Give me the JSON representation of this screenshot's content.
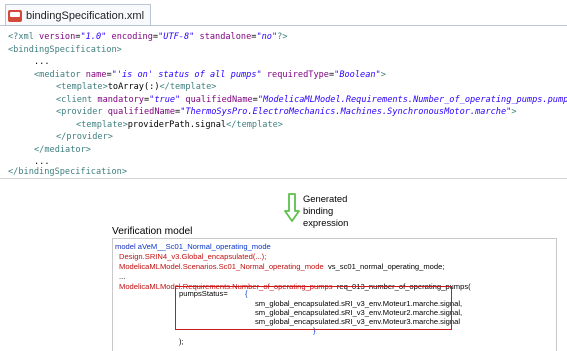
{
  "tab": {
    "filename": "bindingSpecification.xml",
    "icon": "xml-file-icon"
  },
  "xml": {
    "l1": {
      "pi_open": "<?xml ",
      "a1": "version",
      "v1": "\"1.0\"",
      "a2": "encoding",
      "v2": "\"UTF-8\"",
      "a3": "standalone",
      "v3": "\"no\"",
      "pi_close": "?>"
    },
    "l2": "<bindingSpecification>",
    "l3": "...",
    "l4": {
      "open": "<mediator ",
      "a1": "name",
      "v1": "\"'is on' status of all pumps\"",
      "a2": "requiredType",
      "v2": "\"Boolean\"",
      "close": ">"
    },
    "l5": {
      "open": "<template>",
      "text": "toArray(:)",
      "close": "</template>"
    },
    "l6": {
      "open": "<client ",
      "a1": "mandatory",
      "v1": "\"true\"",
      "a2": "qualifiedName",
      "v2": "\"ModelicaMLModel.Requirements.Number_of_operating_pumps.pumpsOnStatus\"",
      "close": "/"
    },
    "l7": {
      "open": "<provider ",
      "a1": "qualifiedName",
      "v1": "\"ThermoSysPro.ElectroMechanics.Machines.SynchronousMotor.marche\"",
      "close": ">"
    },
    "l8": {
      "open": "<template>",
      "text": "providerPath.signal",
      "close": "</template>"
    },
    "l9": "</provider>",
    "l10": "</mediator>",
    "l11": "...",
    "l12": "</bindingSpecification>"
  },
  "arrow": {
    "icon": "down-arrow-icon",
    "line1": "Generated",
    "line2": "binding",
    "line3": "expression"
  },
  "verification": {
    "title": "Verification model",
    "code": {
      "l1_kw": "model",
      "l1_text": " aVeM__Sc01_Normal_operating_mode",
      "l2": "Design.SRIN4_v3.Global_encapsulated(...);",
      "l3_red": "ModelicaMLModel.Scenarios.Sc01_Normal_operating_mode",
      "l3_text": "  vs_sc01_normal_operating_mode;",
      "l4": "...",
      "l5_red": "ModelicaMLModel.Requirements.Number_of_operating_pumps",
      "l5_text": "  req_013_number_of_operating_pumps(",
      "l6_name": "pumpsStatus=",
      "l6_brace": "{",
      "l7": "sm_global_encapsulated.sRI_v3_env.Moteur1.marche.signal,",
      "l8": "sm_global_encapsulated.sRI_v3_env.Moteur2.marche.signal,",
      "l9": "sm_global_encapsulated.sRI_v3_env.Moteur3.marche.signal",
      "l10": "}",
      "l11": ");",
      "l12": "..."
    }
  },
  "colors": {
    "highlight": "#d01818",
    "arrow": "#5dbf4a",
    "keyword": "#1a2fb8",
    "red_text": "#c01010"
  }
}
